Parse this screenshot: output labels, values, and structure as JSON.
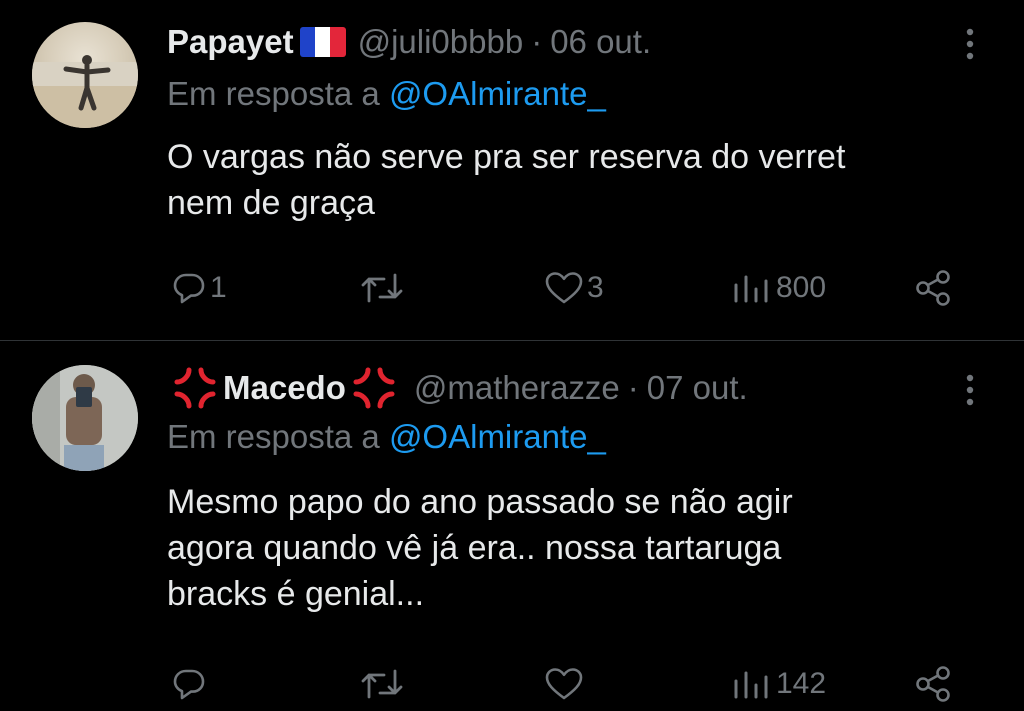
{
  "tweets": [
    {
      "name": "Papayet",
      "handle": "@juli0bbbb",
      "separator": "·",
      "date": "06 out.",
      "reply_prefix": "Em resposta a",
      "reply_mention": "@OAlmirante_",
      "body_lines": [
        "O vargas não serve pra ser reserva do verret",
        "nem de graça"
      ],
      "reply_count": "1",
      "retweet_count": "",
      "like_count": "3",
      "view_count": "800",
      "icons": {
        "reply": "reply-icon",
        "retweet": "retweet-icon",
        "like": "heart-icon",
        "views": "views-icon",
        "share": "share-icon",
        "more": "more-icon",
        "badge": "france-flag-icon"
      }
    },
    {
      "name": "Macedo",
      "handle": "@matherazze",
      "separator": "·",
      "date": "07 out.",
      "reply_prefix": "Em resposta a",
      "reply_mention": "@OAlmirante_",
      "body_lines": [
        "Mesmo papo do ano passado se não agir",
        "agora quando vê já era.. nossa tartaruga",
        "bracks é genial..."
      ],
      "reply_count": "",
      "retweet_count": "",
      "like_count": "",
      "view_count": "142",
      "icons": {
        "reply": "reply-icon",
        "retweet": "retweet-icon",
        "like": "heart-icon",
        "views": "views-icon",
        "share": "share-icon",
        "more": "more-icon",
        "badge": "anger-symbol-emoji"
      }
    }
  ],
  "colors": {
    "background": "#000000",
    "text": "#e7e9ea",
    "muted": "#71767b",
    "link": "#1d9bf0",
    "emoji_red": "#e0242f"
  }
}
